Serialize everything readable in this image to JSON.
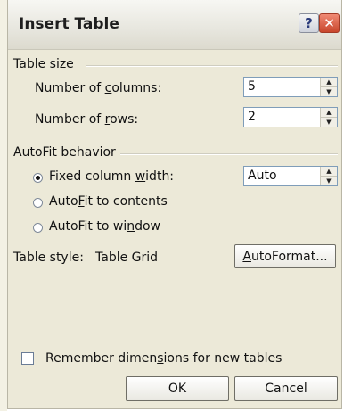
{
  "window": {
    "title": "Insert Table",
    "help_glyph": "?",
    "close_glyph": "✕"
  },
  "table_size": {
    "label": "Table size",
    "columns": {
      "label_pre": "Number of ",
      "mnemonic": "c",
      "label_post": "olumns:",
      "value": "5"
    },
    "rows": {
      "label_pre": "Number of ",
      "mnemonic": "r",
      "label_post": "ows:",
      "value": "2"
    }
  },
  "autofit": {
    "label": "AutoFit behavior",
    "fixed": {
      "label_pre": "Fixed column ",
      "mnemonic": "w",
      "label_post": "idth:",
      "selected": true,
      "value": "Auto"
    },
    "contents": {
      "label_pre": "Auto",
      "mnemonic": "F",
      "label_post": "it to contents",
      "selected": false
    },
    "window": {
      "label_pre": "AutoFit to wi",
      "mnemonic": "n",
      "label_post": "dow",
      "selected": false
    }
  },
  "table_style": {
    "label": "Table style:",
    "value": "Table Grid"
  },
  "autoformat_button": {
    "label_pre": "",
    "mnemonic": "A",
    "label_post": "utoFormat..."
  },
  "remember": {
    "label_pre": "Remember dimen",
    "mnemonic": "s",
    "label_post": "ions for new tables",
    "checked": false
  },
  "buttons": {
    "ok": "OK",
    "cancel": "Cancel"
  },
  "spinner_glyphs": {
    "up": "▲",
    "down": "▼"
  },
  "colors": {
    "dialog_bg": "#ece9d8",
    "close_button": "#c8462c",
    "input_border": "#7f9db9"
  }
}
